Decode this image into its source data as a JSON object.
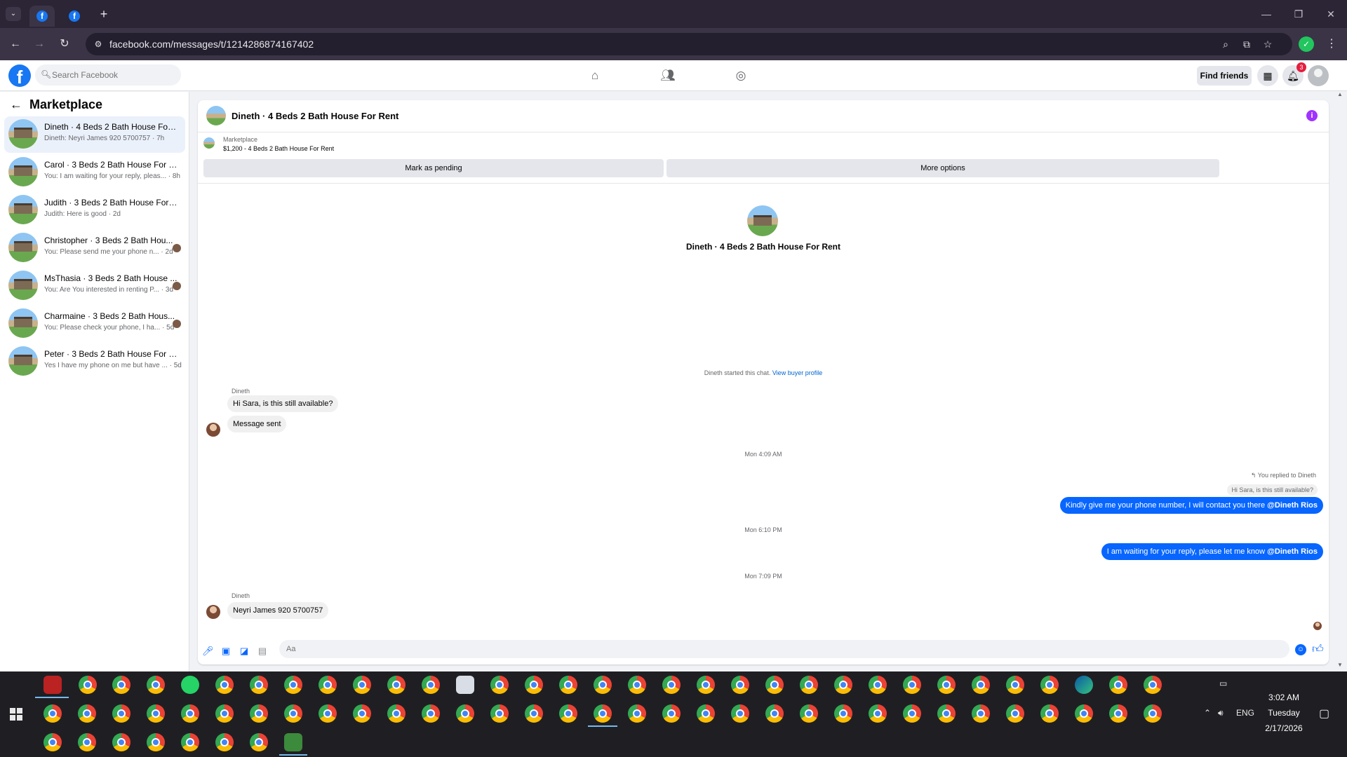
{
  "browser": {
    "url": "facebook.com/messages/t/1214286874167402"
  },
  "facebook": {
    "search_placeholder": "Search Facebook",
    "find_friends": "Find friends",
    "notification_count": "3",
    "logo_letter": "f"
  },
  "sidebar": {
    "title": "Marketplace",
    "conversations": [
      {
        "name": "Dineth · 4 Beds 2 Bath House For ...",
        "snippet": "Dineth: Neyri James 920 5700757 · 7h"
      },
      {
        "name": "Carol · 3 Beds 2 Bath House For Re...",
        "snippet": "You: I am waiting for your reply, pleas... · 8h"
      },
      {
        "name": "Judith · 3 Beds 2 Bath House For R...",
        "snippet": "Judith: Here is good · 2d"
      },
      {
        "name": "Christopher · 3 Beds 2 Bath Hou...",
        "snippet": "You: Please send me your phone n... · 2d"
      },
      {
        "name": "MsThasia · 3 Beds 2 Bath House ...",
        "snippet": "You: Are You interested in renting P... · 3d"
      },
      {
        "name": "Charmaine · 3 Beds 2 Bath Hous...",
        "snippet": "You: Please check your phone, I ha... · 5d"
      },
      {
        "name": "Peter · 3 Beds 2 Bath House For Re...",
        "snippet": "Yes I have my phone on me but have ... · 5d"
      }
    ]
  },
  "chat": {
    "title": "Dineth · 4 Beds 2 Bath House For Rent",
    "listing_label": "Marketplace",
    "listing_price": "$1,200 - 4 Beds 2 Bath House For Rent",
    "mark_pending": "Mark as pending",
    "more_options": "More options",
    "center_title": "Dineth · 4 Beds 2 Bath House For Rent",
    "started": "Dineth started this chat.",
    "view_profile": "View buyer profile",
    "sender_name": "Dineth",
    "msg1": "Hi Sara, is this still available?",
    "msg2": "Message sent",
    "ts1": "Mon 4:09 AM",
    "replied_to": "You replied to Dineth",
    "quoted": "Hi Sara, is this still available?",
    "out1_text": "Kindly give me your phone number, I will contact you there ",
    "out1_mention": "@Dineth Rios",
    "ts2": "Mon 6:10 PM",
    "out2_text": "I am waiting for your reply, please let me know ",
    "out2_mention": "@Dineth Rios",
    "ts3": "Mon 7:09 PM",
    "sender_name2": "Dineth",
    "msg3": "Neyri James 920 5700757",
    "input_placeholder": "Aa"
  },
  "taskbar": {
    "time": "3:02 AM",
    "day": "Tuesday",
    "date": "2/17/2026",
    "lang": "ENG"
  },
  "colors": {
    "facebook_blue": "#1877f2",
    "outgoing_bubble": "#0866ff",
    "active_conversation": "#ebf1fb"
  }
}
